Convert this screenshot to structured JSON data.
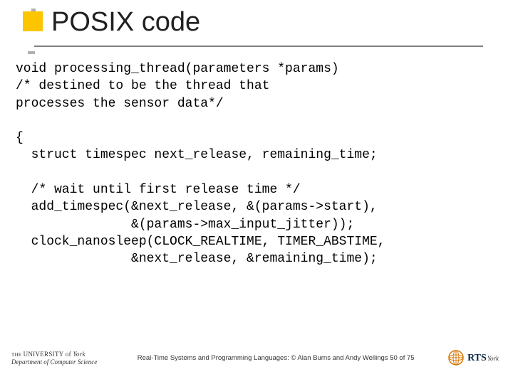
{
  "title": "POSIX code",
  "code_lines": {
    "l1": "void processing_thread(parameters *params)",
    "l2": "/* destined to be the thread that",
    "l3": "processes the sensor data*/",
    "l4": "",
    "l5": "{",
    "l6": "  struct timespec next_release, remaining_time;",
    "l7": "",
    "l8": "  /* wait until first release time */",
    "l9": "  add_timespec(&next_release, &(params->start),",
    "l10": "               &(params->max_input_jitter));",
    "l11": "  clock_nanosleep(CLOCK_REALTIME, TIMER_ABSTIME,",
    "l12": "               &next_release, &remaining_time);"
  },
  "footer": {
    "uni_prefix": "THE ",
    "uni": "UNIVERSITY",
    "uni_of": " of ",
    "uni_name": "York",
    "dept": "Department of Computer Science",
    "caption": "Real-Time Systems and Programming Languages: © Alan Burns and Andy Wellings  50 of 75",
    "rts": "RTS",
    "rts_sub": "York"
  }
}
